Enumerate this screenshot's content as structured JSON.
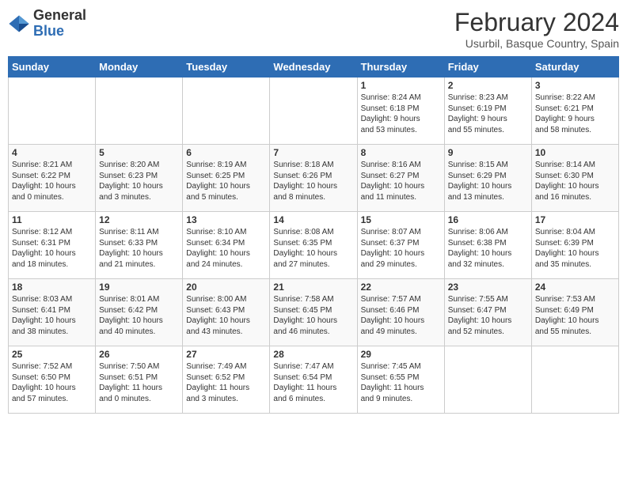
{
  "header": {
    "logo_general": "General",
    "logo_blue": "Blue",
    "title": "February 2024",
    "location": "Usurbil, Basque Country, Spain"
  },
  "days_of_week": [
    "Sunday",
    "Monday",
    "Tuesday",
    "Wednesday",
    "Thursday",
    "Friday",
    "Saturday"
  ],
  "weeks": [
    [
      {
        "num": "",
        "info": ""
      },
      {
        "num": "",
        "info": ""
      },
      {
        "num": "",
        "info": ""
      },
      {
        "num": "",
        "info": ""
      },
      {
        "num": "1",
        "info": "Sunrise: 8:24 AM\nSunset: 6:18 PM\nDaylight: 9 hours\nand 53 minutes."
      },
      {
        "num": "2",
        "info": "Sunrise: 8:23 AM\nSunset: 6:19 PM\nDaylight: 9 hours\nand 55 minutes."
      },
      {
        "num": "3",
        "info": "Sunrise: 8:22 AM\nSunset: 6:21 PM\nDaylight: 9 hours\nand 58 minutes."
      }
    ],
    [
      {
        "num": "4",
        "info": "Sunrise: 8:21 AM\nSunset: 6:22 PM\nDaylight: 10 hours\nand 0 minutes."
      },
      {
        "num": "5",
        "info": "Sunrise: 8:20 AM\nSunset: 6:23 PM\nDaylight: 10 hours\nand 3 minutes."
      },
      {
        "num": "6",
        "info": "Sunrise: 8:19 AM\nSunset: 6:25 PM\nDaylight: 10 hours\nand 5 minutes."
      },
      {
        "num": "7",
        "info": "Sunrise: 8:18 AM\nSunset: 6:26 PM\nDaylight: 10 hours\nand 8 minutes."
      },
      {
        "num": "8",
        "info": "Sunrise: 8:16 AM\nSunset: 6:27 PM\nDaylight: 10 hours\nand 11 minutes."
      },
      {
        "num": "9",
        "info": "Sunrise: 8:15 AM\nSunset: 6:29 PM\nDaylight: 10 hours\nand 13 minutes."
      },
      {
        "num": "10",
        "info": "Sunrise: 8:14 AM\nSunset: 6:30 PM\nDaylight: 10 hours\nand 16 minutes."
      }
    ],
    [
      {
        "num": "11",
        "info": "Sunrise: 8:12 AM\nSunset: 6:31 PM\nDaylight: 10 hours\nand 18 minutes."
      },
      {
        "num": "12",
        "info": "Sunrise: 8:11 AM\nSunset: 6:33 PM\nDaylight: 10 hours\nand 21 minutes."
      },
      {
        "num": "13",
        "info": "Sunrise: 8:10 AM\nSunset: 6:34 PM\nDaylight: 10 hours\nand 24 minutes."
      },
      {
        "num": "14",
        "info": "Sunrise: 8:08 AM\nSunset: 6:35 PM\nDaylight: 10 hours\nand 27 minutes."
      },
      {
        "num": "15",
        "info": "Sunrise: 8:07 AM\nSunset: 6:37 PM\nDaylight: 10 hours\nand 29 minutes."
      },
      {
        "num": "16",
        "info": "Sunrise: 8:06 AM\nSunset: 6:38 PM\nDaylight: 10 hours\nand 32 minutes."
      },
      {
        "num": "17",
        "info": "Sunrise: 8:04 AM\nSunset: 6:39 PM\nDaylight: 10 hours\nand 35 minutes."
      }
    ],
    [
      {
        "num": "18",
        "info": "Sunrise: 8:03 AM\nSunset: 6:41 PM\nDaylight: 10 hours\nand 38 minutes."
      },
      {
        "num": "19",
        "info": "Sunrise: 8:01 AM\nSunset: 6:42 PM\nDaylight: 10 hours\nand 40 minutes."
      },
      {
        "num": "20",
        "info": "Sunrise: 8:00 AM\nSunset: 6:43 PM\nDaylight: 10 hours\nand 43 minutes."
      },
      {
        "num": "21",
        "info": "Sunrise: 7:58 AM\nSunset: 6:45 PM\nDaylight: 10 hours\nand 46 minutes."
      },
      {
        "num": "22",
        "info": "Sunrise: 7:57 AM\nSunset: 6:46 PM\nDaylight: 10 hours\nand 49 minutes."
      },
      {
        "num": "23",
        "info": "Sunrise: 7:55 AM\nSunset: 6:47 PM\nDaylight: 10 hours\nand 52 minutes."
      },
      {
        "num": "24",
        "info": "Sunrise: 7:53 AM\nSunset: 6:49 PM\nDaylight: 10 hours\nand 55 minutes."
      }
    ],
    [
      {
        "num": "25",
        "info": "Sunrise: 7:52 AM\nSunset: 6:50 PM\nDaylight: 10 hours\nand 57 minutes."
      },
      {
        "num": "26",
        "info": "Sunrise: 7:50 AM\nSunset: 6:51 PM\nDaylight: 11 hours\nand 0 minutes."
      },
      {
        "num": "27",
        "info": "Sunrise: 7:49 AM\nSunset: 6:52 PM\nDaylight: 11 hours\nand 3 minutes."
      },
      {
        "num": "28",
        "info": "Sunrise: 7:47 AM\nSunset: 6:54 PM\nDaylight: 11 hours\nand 6 minutes."
      },
      {
        "num": "29",
        "info": "Sunrise: 7:45 AM\nSunset: 6:55 PM\nDaylight: 11 hours\nand 9 minutes."
      },
      {
        "num": "",
        "info": ""
      },
      {
        "num": "",
        "info": ""
      }
    ]
  ]
}
